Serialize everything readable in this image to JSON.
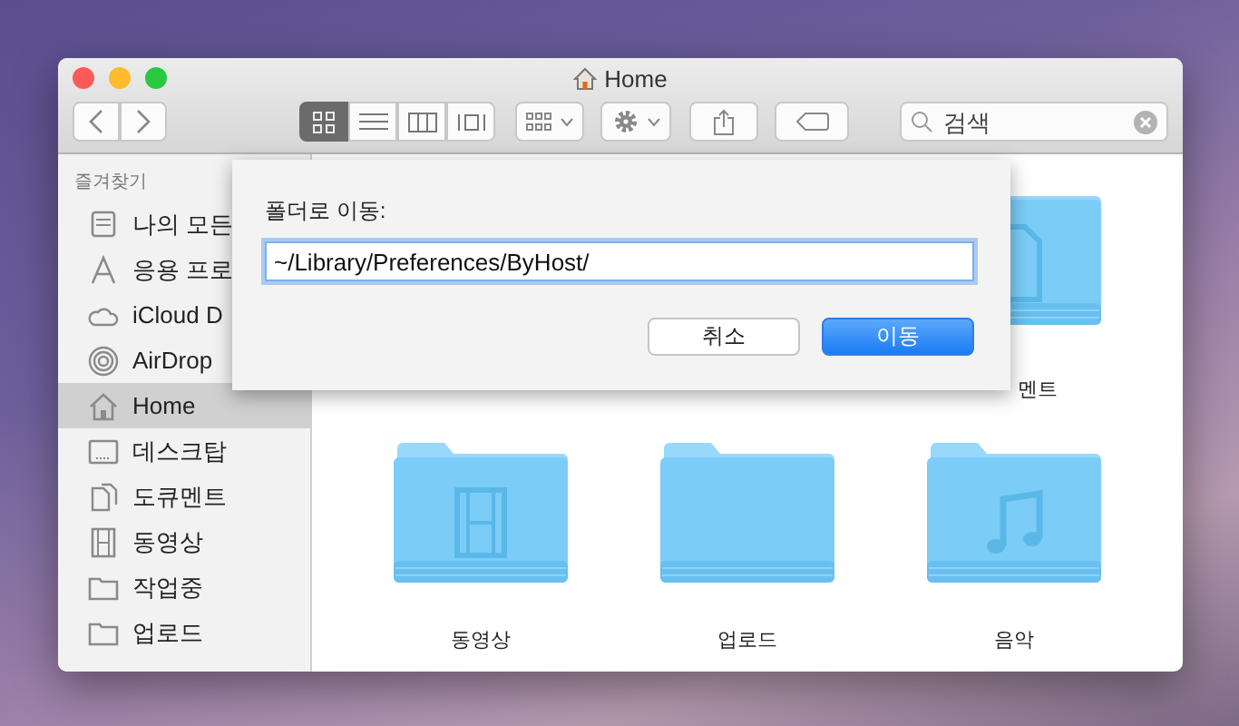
{
  "window": {
    "title": "Home"
  },
  "toolbar": {
    "view_modes": [
      {
        "selected": true
      },
      {
        "selected": false
      },
      {
        "selected": false
      },
      {
        "selected": false
      }
    ],
    "search": {
      "placeholder": "검색"
    }
  },
  "sidebar": {
    "header": "즐겨찾기",
    "items": [
      {
        "label": "나의 모든",
        "selected": false
      },
      {
        "label": "응용 프로",
        "selected": false
      },
      {
        "label": "iCloud D",
        "selected": false
      },
      {
        "label": "AirDrop",
        "selected": false
      },
      {
        "label": "Home",
        "selected": true
      },
      {
        "label": "데스크탑",
        "selected": false
      },
      {
        "label": "도큐멘트",
        "selected": false
      },
      {
        "label": "동영상",
        "selected": false
      },
      {
        "label": "작업중",
        "selected": false
      },
      {
        "label": "업로드",
        "selected": false
      }
    ]
  },
  "folders": [
    {
      "kind": "document",
      "label": "멘트"
    },
    {
      "kind": "movies",
      "label": "동영상"
    },
    {
      "kind": "plain",
      "label": "업로드"
    },
    {
      "kind": "music",
      "label": "음악"
    }
  ],
  "sheet": {
    "label": "폴더로 이동:",
    "path": "~/Library/Preferences/ByHost/",
    "buttons": [
      {
        "label": "취소",
        "default": false
      },
      {
        "label": "이동",
        "default": true
      }
    ]
  }
}
